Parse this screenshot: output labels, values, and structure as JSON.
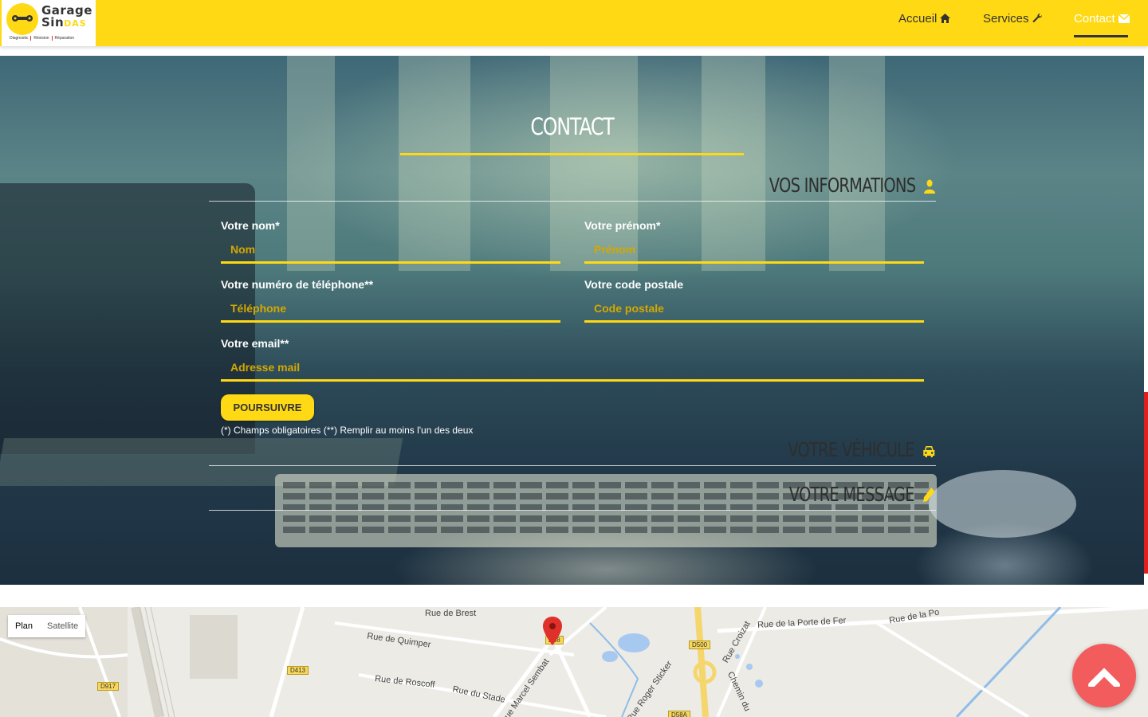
{
  "brand": {
    "name_line1": "Garage",
    "name_line2a": "Sin",
    "name_line2b": "DAS",
    "tags": [
      "Diagnostic",
      "Révision",
      "Réparation"
    ]
  },
  "nav": {
    "items": [
      {
        "label": "Accueil",
        "icon": "home-icon"
      },
      {
        "label": "Services",
        "icon": "wrench-icon"
      },
      {
        "label": "Contact",
        "icon": "envelope-icon",
        "active": true
      }
    ]
  },
  "contact": {
    "title": "CONTACT",
    "sections": {
      "info": {
        "label": "VOS INFORMATIONS",
        "icon": "user-icon"
      },
      "vehicle": {
        "label": "VOTRE VÉHICULE",
        "icon": "car-icon"
      },
      "message": {
        "label": "VOTRE MESSAGE",
        "icon": "pencil-icon"
      }
    },
    "fields": {
      "last_name": {
        "label": "Votre nom*",
        "placeholder": "Nom",
        "value": ""
      },
      "first_name": {
        "label": "Votre prénom*",
        "placeholder": "Prénom",
        "value": ""
      },
      "phone": {
        "label": "Votre numéro de téléphone**",
        "placeholder": "Téléphone",
        "value": ""
      },
      "postal_code": {
        "label": "Votre code postale",
        "placeholder": "Code postale",
        "value": ""
      },
      "email": {
        "label": "Votre email**",
        "placeholder": "Adresse mail",
        "value": ""
      }
    },
    "continue_label": "POURSUIVRE",
    "note": "(*) Champs obligatoires (**) Remplir au moins l'un des deux"
  },
  "map": {
    "toggle": {
      "plan": "Plan",
      "satellite": "Satellite",
      "selected": "Plan"
    },
    "streets": {
      "brest": "Rue de Brest",
      "quimper": "Rue de Quimper",
      "roscoff": "Rue de Roscoff",
      "stade": "Rue du Stade",
      "sembat": "Rue Marcel Sembat",
      "porte_fer": "Rue de la Porte de Fer",
      "croizat": "Rue Croizat",
      "sticker": "Rue Roger Sticker",
      "chemin": "Chemin du",
      "rue_de_la": "Rue de la Po"
    },
    "routes": [
      "D917",
      "D413",
      "D500",
      "D58",
      "D58A"
    ]
  },
  "colors": {
    "accent": "#ffd913",
    "text_dark": "#333333",
    "scroll_top": "#f25c5c",
    "red_strip": "#e0201c"
  }
}
